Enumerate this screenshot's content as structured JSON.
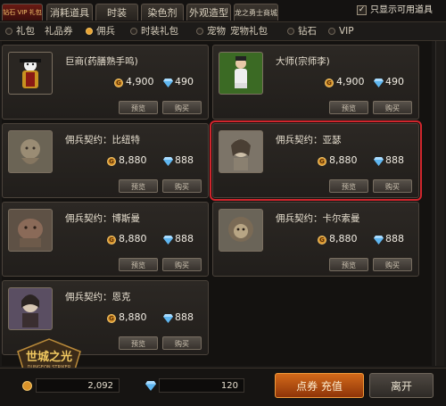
{
  "tabs": [
    {
      "label": "钻石 VIP 礼包",
      "active": true
    },
    {
      "label": "消耗道具"
    },
    {
      "label": "时装"
    },
    {
      "label": "染色剂"
    },
    {
      "label": "外观造型"
    },
    {
      "label": "龙之勇士商城"
    }
  ],
  "only_available": {
    "label": "只显示可用道具",
    "checked": true,
    "check_glyph": "✓"
  },
  "filters": [
    {
      "label": "礼包",
      "selected": false
    },
    {
      "label": "礼品券"
    },
    {
      "label": "佣兵",
      "selected": true
    },
    {
      "label": "时装礼包",
      "selected": false
    },
    {
      "label": "宠物",
      "selected": false
    },
    {
      "label": "宠物礼包"
    },
    {
      "label": "钻石",
      "selected": false
    },
    {
      "label": "VIP",
      "selected": false
    }
  ],
  "cards": [
    {
      "name": "巨商(药膳熟手鸣)",
      "gold": "4,900",
      "diamond": "490",
      "preview": "预览",
      "buy": "购买"
    },
    {
      "name": "大师(宗师李)",
      "gold": "4,900",
      "diamond": "490",
      "preview": "预览",
      "buy": "购买"
    },
    {
      "name": "佣兵契约：比纽特",
      "gold": "8,880",
      "diamond": "888",
      "preview": "预览",
      "buy": "购买"
    },
    {
      "name": "佣兵契约：亚瑟",
      "gold": "8,880",
      "diamond": "888",
      "preview": "预览",
      "buy": "购买",
      "selected": true
    },
    {
      "name": "佣兵契约：博斯曼",
      "gold": "8,880",
      "diamond": "888",
      "preview": "预览",
      "buy": "购买"
    },
    {
      "name": "佣兵契约：卡尔索曼",
      "gold": "8,880",
      "diamond": "888",
      "preview": "预览",
      "buy": "购买"
    },
    {
      "name": "佣兵契约：恩克",
      "gold": "8,880",
      "diamond": "888",
      "preview": "预览",
      "buy": "购买"
    }
  ],
  "bottom": {
    "gold_balance": "2,092",
    "diamond_balance": "120",
    "recharge_label": "点券 充值",
    "leave_label": "离开"
  },
  "logo": {
    "text": "世城之光",
    "subtext": "DUNGEON STRIKER"
  },
  "colors": {
    "gold": "#d9932a",
    "diamond": "#5fb6f0",
    "selected_border": "#d0262d",
    "accent": "#e9a333"
  }
}
